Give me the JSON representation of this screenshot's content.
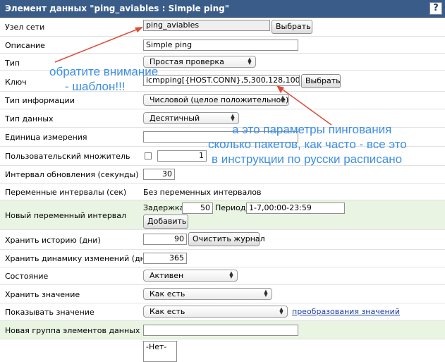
{
  "window": {
    "title": "Элемент данных \"ping_aviables : Simple ping\"",
    "help": "?"
  },
  "host": {
    "label": "Узел сети",
    "value": "ping_aviables",
    "button": "Выбрать"
  },
  "description": {
    "label": "Описание",
    "value": "Simple ping"
  },
  "type": {
    "label": "Тип",
    "value": "Простая проверка"
  },
  "key": {
    "label": "Ключ",
    "value": "icmpping[{HOST.CONN},5,300,128,100]",
    "button": "Выбрать"
  },
  "info_type": {
    "label": "Тип информации",
    "value": "Числовой (целое положительное)"
  },
  "data_type": {
    "label": "Тип данных",
    "value": "Десятичный"
  },
  "units": {
    "label": "Единица измерения",
    "value": ""
  },
  "multiplier": {
    "label": "Пользовательский множитель",
    "value": "1"
  },
  "interval": {
    "label": "Интервал обновления (секунды)",
    "value": "30"
  },
  "flex": {
    "label": "Переменные интервалы (сек)",
    "value": "Без переменных интервалов"
  },
  "new_flex": {
    "label": "Новый переменный интервал",
    "delay_label": "Задержка",
    "delay_value": "50",
    "period_label": "Период",
    "period_value": "1-7,00:00-23:59",
    "add_button": "Добавить"
  },
  "history": {
    "label": "Хранить историю (дни)",
    "value": "90",
    "button": "Очистить журнал"
  },
  "trends": {
    "label": "Хранить динамику изменений (дни)",
    "value": "365"
  },
  "status": {
    "label": "Состояние",
    "value": "Активен"
  },
  "store_value": {
    "label": "Хранить значение",
    "value": "Как есть"
  },
  "show_value": {
    "label": "Показывать значение",
    "value": "Как есть",
    "link": "преобразования значений"
  },
  "new_group": {
    "label": "Новая группа элементов данных",
    "value": ""
  },
  "groups_list": {
    "options": [
      "-Нет-"
    ]
  },
  "annotations": {
    "note1_line1": "обратите внимание",
    "note1_line2": "- шаблон!!!",
    "note2_line1": "а это параметры пингования",
    "note2_line2": "сколько пакетов, как часто - все это",
    "note2_line3": "в инструкции по русски расписано",
    "color": "#3c8ee6",
    "arrow_color": "#e04a3a"
  }
}
